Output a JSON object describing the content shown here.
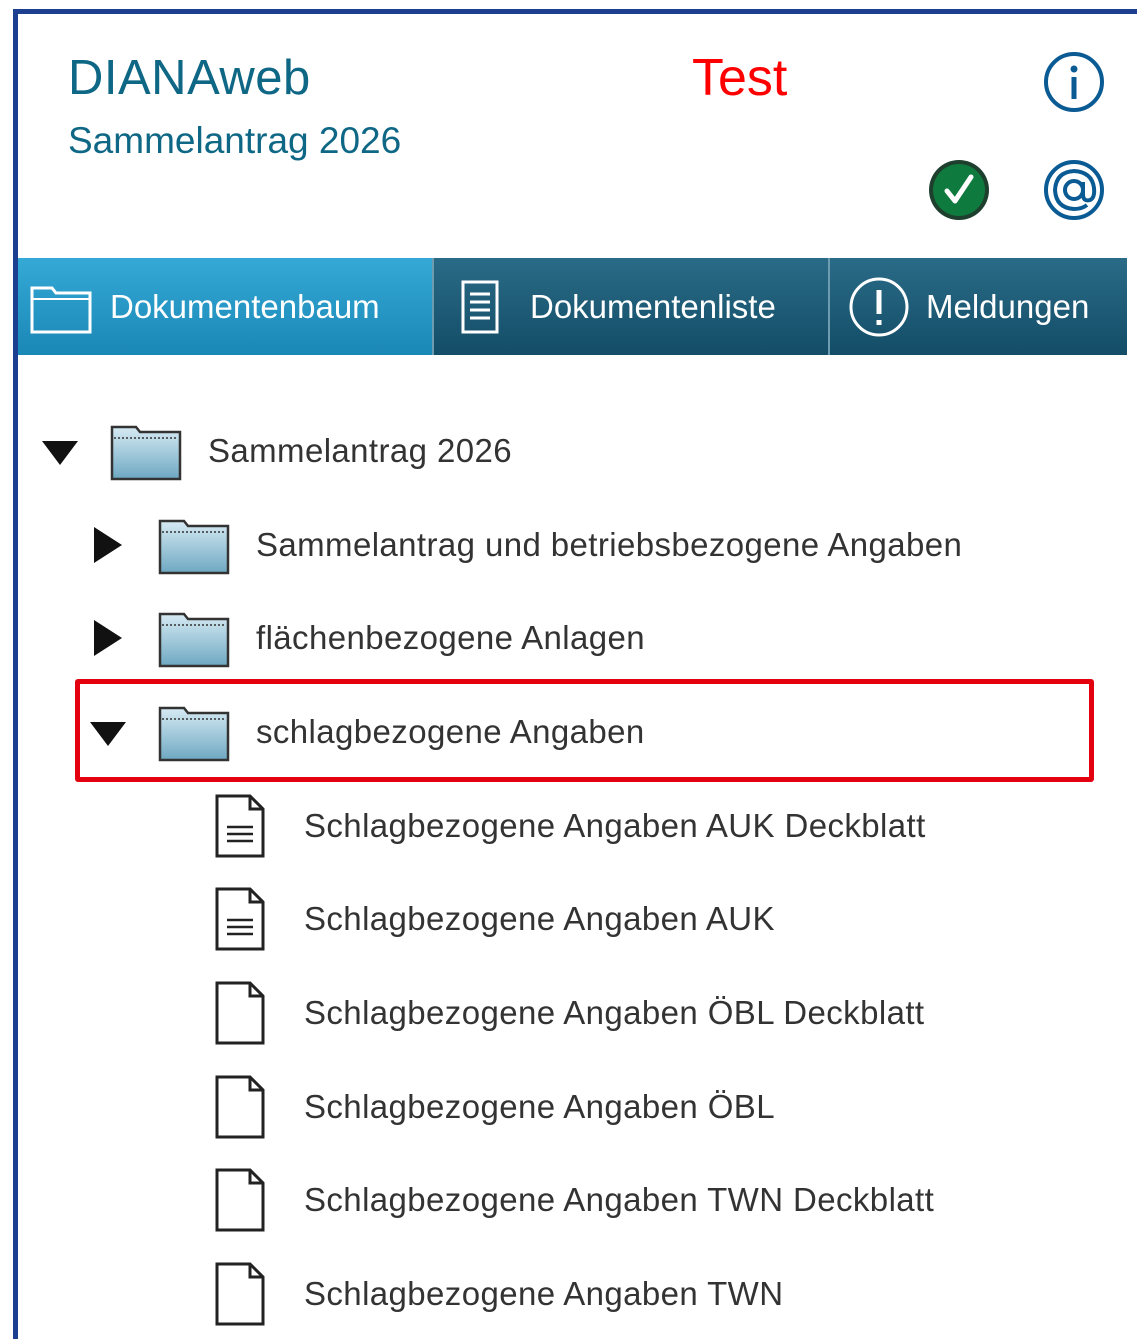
{
  "header": {
    "app_title": "DIANAweb",
    "subtitle": "Sammelantrag 2026",
    "environment": "Test",
    "icons": [
      "info-icon",
      "check-status-icon",
      "email-icon"
    ]
  },
  "tabs": [
    {
      "label": "Dokumentenbaum",
      "icon": "folder-icon",
      "active": true
    },
    {
      "label": "Dokumentenliste",
      "icon": "document-list-icon",
      "active": false
    },
    {
      "label": "Meldungen",
      "icon": "exclamation-icon",
      "active": false
    }
  ],
  "tree": {
    "root": {
      "label": "Sammelantrag 2026",
      "expanded": true
    },
    "folders": [
      {
        "label": "Sammelantrag und betriebsbezogene Angaben",
        "expanded": false
      },
      {
        "label": "flächenbezogene Anlagen",
        "expanded": false
      },
      {
        "label": "schlagbezogene Angaben",
        "expanded": true,
        "highlighted": true
      }
    ],
    "documents": [
      {
        "label": "Schlagbezogene Angaben AUK Deckblatt",
        "filled": true
      },
      {
        "label": "Schlagbezogene Angaben AUK",
        "filled": true
      },
      {
        "label": "Schlagbezogene Angaben ÖBL Deckblatt",
        "filled": false
      },
      {
        "label": "Schlagbezogene Angaben ÖBL",
        "filled": false
      },
      {
        "label": "Schlagbezogene Angaben TWN Deckblatt",
        "filled": false
      },
      {
        "label": "Schlagbezogene Angaben TWN",
        "filled": false
      }
    ]
  },
  "colors": {
    "brand": "#0e6785",
    "environment": "#ff0000",
    "tab_active": "#1a87b6",
    "tab_inactive": "#134d67",
    "highlight": "#e3000f",
    "status_ok": "#0f7a3d"
  }
}
